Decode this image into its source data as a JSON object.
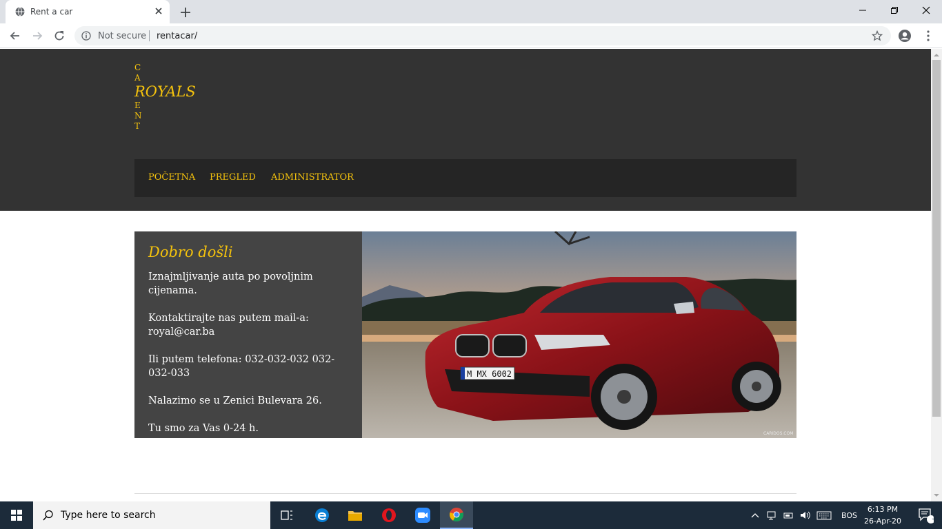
{
  "browser": {
    "tab_title": "Rent a car",
    "security_label": "Not secure",
    "url": "rentacar/"
  },
  "site": {
    "logo_top": [
      "C",
      "A"
    ],
    "logo_main": "ROYALS",
    "logo_bottom": [
      "E",
      "N",
      "T"
    ],
    "nav": [
      "POČETNA",
      "PREGLED",
      "ADMINISTRATOR"
    ],
    "welcome_title": "Dobro došli",
    "paragraphs": [
      "Iznajmljivanje auta po povoljnim cijenama.",
      "Kontaktirajte nas putem mail-a: royal@car.ba",
      "Ili putem telefona: 032-032-032 032-032-033",
      "Nalazimo se u Zenici Bulevara 26.",
      "Tu smo za Vas 0-24 h."
    ],
    "plate": "M MX 6002",
    "watermark": "CARIDOS.COM"
  },
  "taskbar": {
    "search_placeholder": "Type here to search",
    "language": "BOS",
    "time": "6:13 PM",
    "date": "26-Apr-20",
    "notifications": "3"
  },
  "colors": {
    "accent": "#f4c20d",
    "header_bg": "#333333",
    "nav_bg": "#252525",
    "panel_bg": "#444444"
  }
}
